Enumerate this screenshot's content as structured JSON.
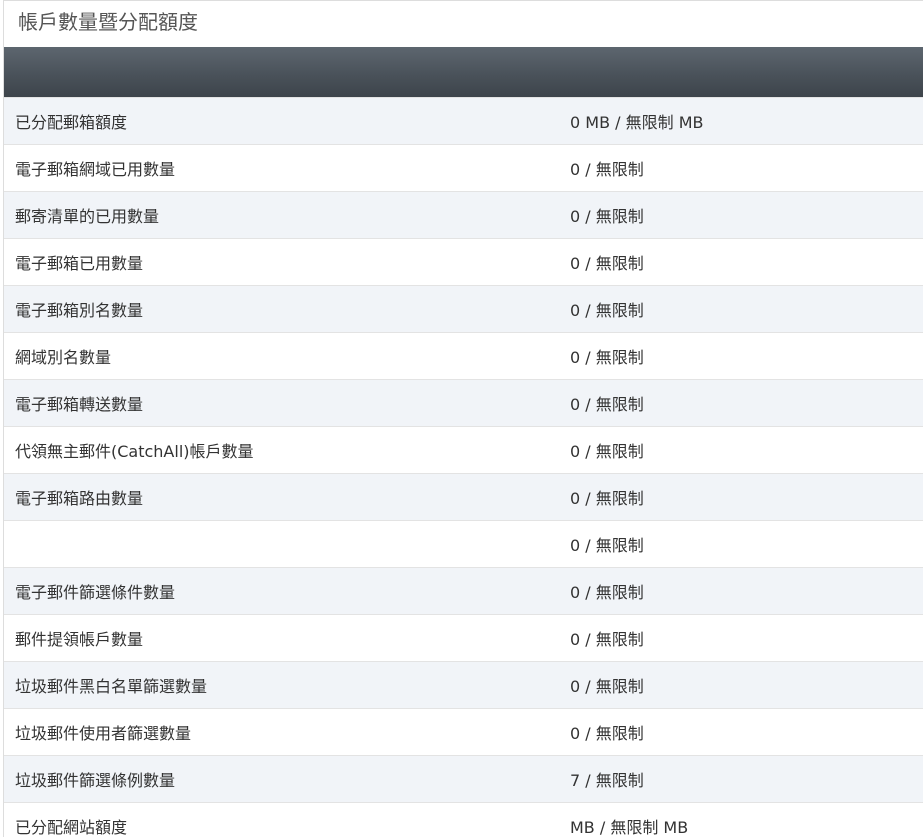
{
  "panel": {
    "title": "帳戶數量暨分配額度"
  },
  "rows": [
    {
      "label": "已分配郵箱額度",
      "value": "0 MB / 無限制 MB"
    },
    {
      "label": "電子郵箱網域已用數量",
      "value": "0 / 無限制"
    },
    {
      "label": "郵寄清單的已用數量",
      "value": "0 / 無限制"
    },
    {
      "label": "電子郵箱已用數量",
      "value": "0 / 無限制"
    },
    {
      "label": "電子郵箱別名數量",
      "value": "0 / 無限制"
    },
    {
      "label": "網域別名數量",
      "value": "0 / 無限制"
    },
    {
      "label": "電子郵箱轉送數量",
      "value": "0 / 無限制"
    },
    {
      "label": "代領無主郵件(CatchAll)帳戶數量",
      "value": "0 / 無限制"
    },
    {
      "label": "電子郵箱路由數量",
      "value": "0 / 無限制"
    },
    {
      "label": "",
      "value": "0 / 無限制"
    },
    {
      "label": "電子郵件篩選條件數量",
      "value": "0 / 無限制"
    },
    {
      "label": "郵件提領帳戶數量",
      "value": "0 / 無限制"
    },
    {
      "label": "垃圾郵件黑白名單篩選數量",
      "value": "0 / 無限制"
    },
    {
      "label": "垃圾郵件使用者篩選數量",
      "value": "0 / 無限制"
    },
    {
      "label": "垃圾郵件篩選條例數量",
      "value": "7 / 無限制"
    },
    {
      "label": "已分配網站額度",
      "value": "MB / 無限制 MB"
    }
  ]
}
